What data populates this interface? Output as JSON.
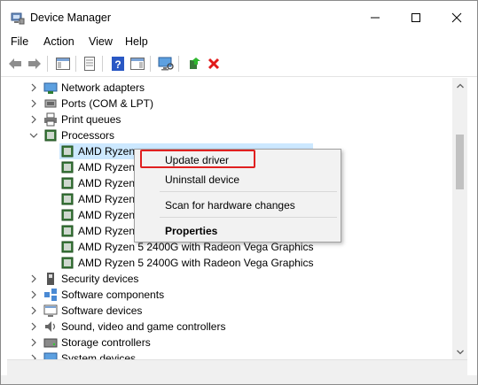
{
  "window": {
    "title": "Device Manager"
  },
  "menu": [
    "File",
    "Action",
    "View",
    "Help"
  ],
  "toolbar": {
    "buttons": [
      "back-icon",
      "forward-icon",
      "show-hide-tree-icon",
      "properties-icon",
      "help-icon",
      "action-pane-icon",
      "scan-hardware-icon",
      "update-driver-icon",
      "uninstall-icon"
    ]
  },
  "tree": {
    "items": [
      {
        "label": "Network adapters",
        "expanded": false,
        "icon": "network-adapter-icon"
      },
      {
        "label": "Ports (COM & LPT)",
        "expanded": false,
        "icon": "port-icon"
      },
      {
        "label": "Print queues",
        "expanded": false,
        "icon": "printer-icon"
      },
      {
        "label": "Processors",
        "expanded": true,
        "icon": "processor-icon"
      },
      {
        "label": "AMD Ryzen",
        "child": true,
        "selected": true,
        "icon": "cpu-chip-icon"
      },
      {
        "label": "AMD Ryzen",
        "child": true,
        "icon": "cpu-chip-icon"
      },
      {
        "label": "AMD Ryzen",
        "child": true,
        "icon": "cpu-chip-icon"
      },
      {
        "label": "AMD Ryzen",
        "child": true,
        "icon": "cpu-chip-icon"
      },
      {
        "label": "AMD Ryzen",
        "child": true,
        "icon": "cpu-chip-icon"
      },
      {
        "label": "AMD Ryzen",
        "child": true,
        "icon": "cpu-chip-icon"
      },
      {
        "label": "AMD Ryzen 5 2400G with Radeon Vega Graphics",
        "child": true,
        "icon": "cpu-chip-icon"
      },
      {
        "label": "AMD Ryzen 5 2400G with Radeon Vega Graphics",
        "child": true,
        "icon": "cpu-chip-icon"
      },
      {
        "label": "Security devices",
        "expanded": false,
        "icon": "security-device-icon"
      },
      {
        "label": "Software components",
        "expanded": false,
        "icon": "software-component-icon"
      },
      {
        "label": "Software devices",
        "expanded": false,
        "icon": "software-device-icon"
      },
      {
        "label": "Sound, video and game controllers",
        "expanded": false,
        "icon": "sound-icon"
      },
      {
        "label": "Storage controllers",
        "expanded": false,
        "icon": "storage-icon"
      },
      {
        "label": "System devices",
        "expanded": false,
        "icon": "system-device-icon"
      }
    ]
  },
  "context_menu": {
    "items": [
      {
        "label": "Update driver",
        "bold": false
      },
      {
        "label": "Uninstall device",
        "bold": false
      },
      {
        "label": "Scan for hardware changes",
        "bold": false
      },
      {
        "label": "Properties",
        "bold": true
      }
    ]
  },
  "colors": {
    "highlight": "#e02020",
    "selection": "#cce8ff",
    "uninstall_red": "#e11a1a"
  }
}
